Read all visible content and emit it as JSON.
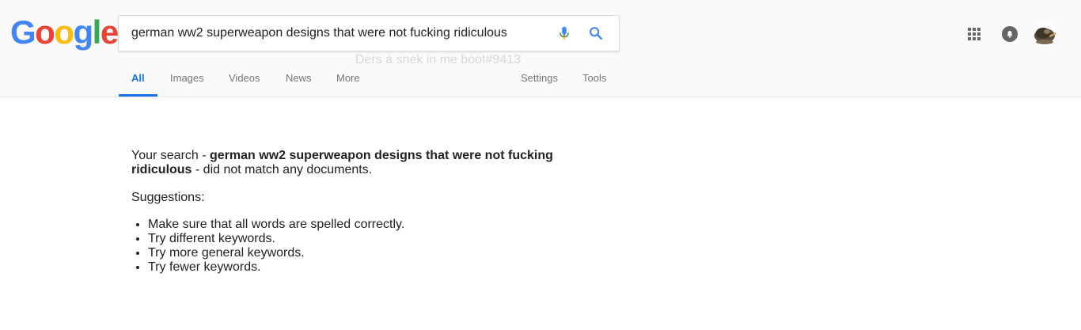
{
  "logo": {
    "letters": [
      "G",
      "o",
      "o",
      "g",
      "l",
      "e"
    ],
    "colors": [
      "#4285F4",
      "#EA4335",
      "#FBBC05",
      "#4285F4",
      "#34A853",
      "#EA4335"
    ]
  },
  "search": {
    "query": "german ww2 superweapon designs that were not fucking ridiculous"
  },
  "watermark": "Ders a snek in me boot#9413",
  "tabs": {
    "all": "All",
    "images": "Images",
    "videos": "Videos",
    "news": "News",
    "more": "More",
    "settings": "Settings",
    "tools": "Tools"
  },
  "icons": {
    "mic": "microphone-icon",
    "search": "search-icon",
    "apps": "apps-grid-icon",
    "notifications": "notifications-icon",
    "avatar": "avatar"
  },
  "colors": {
    "accent": "#1a73e8",
    "tab_text": "#777777"
  },
  "results": {
    "prefix": "Your search - ",
    "query_bold": "german ww2 superweapon designs that were not fucking ridiculous",
    "suffix": " - did not match any documents.",
    "suggestions_label": "Suggestions:",
    "suggestions": [
      "Make sure that all words are spelled correctly.",
      "Try different keywords.",
      "Try more general keywords.",
      "Try fewer keywords."
    ]
  }
}
